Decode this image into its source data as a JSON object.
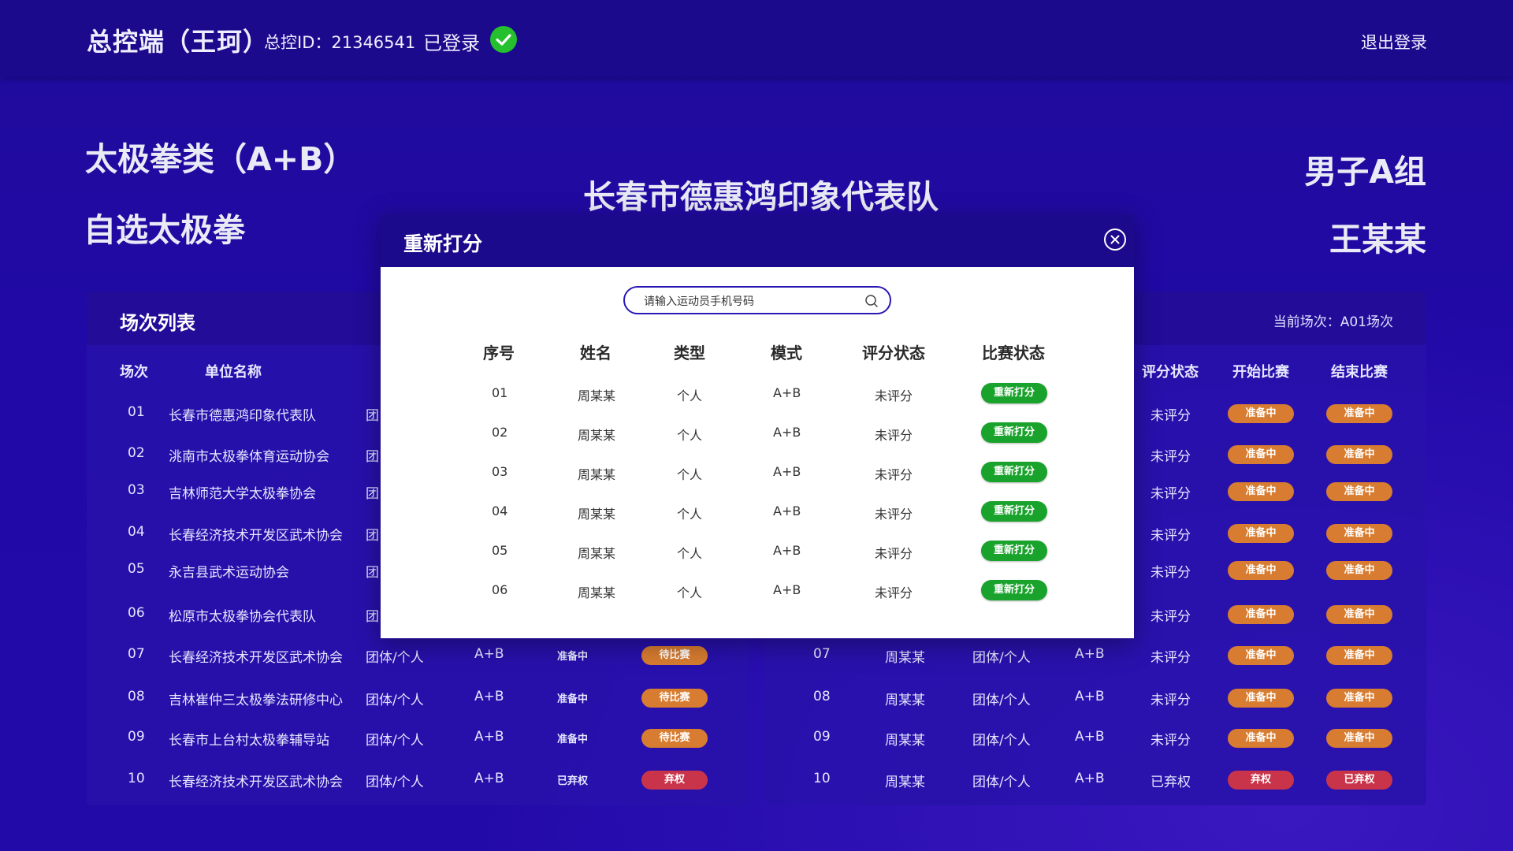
{
  "header": {
    "title": "总控端（王珂）",
    "id_text": "总控ID：21346541",
    "logged_in": "已登录",
    "logout": "退出登录"
  },
  "event": {
    "category": "太极拳类（A+B）",
    "name": "自选太极拳",
    "team": "长春市德惠鸿印象代表队",
    "group": "男子A组",
    "athlete": "王某某"
  },
  "left_panel": {
    "title": "场次列表",
    "columns": [
      "场次",
      "单位名称"
    ],
    "rows": [
      {
        "no": "01",
        "unit": "长春市德惠鸿印象代表队",
        "type": "团",
        "mode": "",
        "state": "",
        "status": "",
        "status_color": ""
      },
      {
        "no": "02",
        "unit": "洮南市太极拳体育运动协会",
        "type": "团",
        "mode": "",
        "state": "",
        "status": "",
        "status_color": ""
      },
      {
        "no": "03",
        "unit": "吉林师范大学太极拳协会",
        "type": "团",
        "mode": "",
        "state": "",
        "status": "",
        "status_color": ""
      },
      {
        "no": "04",
        "unit": "长春经济技术开发区武术协会",
        "type": "团",
        "mode": "",
        "state": "",
        "status": "",
        "status_color": ""
      },
      {
        "no": "05",
        "unit": "永吉县武术运动协会",
        "type": "团",
        "mode": "",
        "state": "",
        "status": "",
        "status_color": ""
      },
      {
        "no": "06",
        "unit": "松原市太极拳协会代表队",
        "type": "团",
        "mode": "",
        "state": "",
        "status": "",
        "status_color": ""
      },
      {
        "no": "07",
        "unit": "长春经济技术开发区武术协会",
        "type": "团体/个人",
        "mode": "A+B",
        "state": "准备中",
        "status": "待比赛",
        "status_color": "orange"
      },
      {
        "no": "08",
        "unit": "吉林崔仲三太极拳法研修中心",
        "type": "团体/个人",
        "mode": "A+B",
        "state": "准备中",
        "status": "待比赛",
        "status_color": "orange"
      },
      {
        "no": "09",
        "unit": "长春市上台村太极拳辅导站",
        "type": "团体/个人",
        "mode": "A+B",
        "state": "准备中",
        "status": "待比赛",
        "status_color": "orange"
      },
      {
        "no": "10",
        "unit": "长春经济技术开发区武术协会",
        "type": "团体/个人",
        "mode": "A+B",
        "state": "已弃权",
        "status": "弃权",
        "status_color": "red"
      }
    ]
  },
  "right_panel": {
    "current": "当前场次：A01场次",
    "columns": [
      "评分状态",
      "开始比赛",
      "结束比赛"
    ],
    "rows": [
      {
        "no": "",
        "name": "",
        "type": "",
        "mode": "",
        "score": "未评分",
        "start": "准备中",
        "end": "准备中",
        "start_color": "orange",
        "end_color": "orange"
      },
      {
        "no": "",
        "name": "",
        "type": "",
        "mode": "",
        "score": "未评分",
        "start": "准备中",
        "end": "准备中",
        "start_color": "orange",
        "end_color": "orange"
      },
      {
        "no": "",
        "name": "",
        "type": "",
        "mode": "",
        "score": "未评分",
        "start": "准备中",
        "end": "准备中",
        "start_color": "orange",
        "end_color": "orange"
      },
      {
        "no": "",
        "name": "",
        "type": "",
        "mode": "",
        "score": "未评分",
        "start": "准备中",
        "end": "准备中",
        "start_color": "orange",
        "end_color": "orange"
      },
      {
        "no": "",
        "name": "",
        "type": "",
        "mode": "",
        "score": "未评分",
        "start": "准备中",
        "end": "准备中",
        "start_color": "orange",
        "end_color": "orange"
      },
      {
        "no": "",
        "name": "",
        "type": "",
        "mode": "",
        "score": "未评分",
        "start": "准备中",
        "end": "准备中",
        "start_color": "orange",
        "end_color": "orange"
      },
      {
        "no": "07",
        "name": "周某某",
        "type": "团体/个人",
        "mode": "A+B",
        "score": "未评分",
        "start": "准备中",
        "end": "准备中",
        "start_color": "orange",
        "end_color": "orange"
      },
      {
        "no": "08",
        "name": "周某某",
        "type": "团体/个人",
        "mode": "A+B",
        "score": "未评分",
        "start": "准备中",
        "end": "准备中",
        "start_color": "orange",
        "end_color": "orange"
      },
      {
        "no": "09",
        "name": "周某某",
        "type": "团体/个人",
        "mode": "A+B",
        "score": "未评分",
        "start": "准备中",
        "end": "准备中",
        "start_color": "orange",
        "end_color": "orange"
      },
      {
        "no": "10",
        "name": "周某某",
        "type": "团体/个人",
        "mode": "A+B",
        "score": "已弃权",
        "start": "弃权",
        "end": "已弃权",
        "start_color": "red",
        "end_color": "red"
      }
    ]
  },
  "modal": {
    "title": "重新打分",
    "search_placeholder": "请输入运动员手机号码",
    "columns": [
      "序号",
      "姓名",
      "类型",
      "模式",
      "评分状态",
      "比赛状态"
    ],
    "rows": [
      {
        "no": "01",
        "name": "周某某",
        "type": "个人",
        "mode": "A+B",
        "score": "未评分",
        "action": "重新打分"
      },
      {
        "no": "02",
        "name": "周某某",
        "type": "个人",
        "mode": "A+B",
        "score": "未评分",
        "action": "重新打分"
      },
      {
        "no": "03",
        "name": "周某某",
        "type": "个人",
        "mode": "A+B",
        "score": "未评分",
        "action": "重新打分"
      },
      {
        "no": "04",
        "name": "周某某",
        "type": "个人",
        "mode": "A+B",
        "score": "未评分",
        "action": "重新打分"
      },
      {
        "no": "05",
        "name": "周某某",
        "type": "个人",
        "mode": "A+B",
        "score": "未评分",
        "action": "重新打分"
      },
      {
        "no": "06",
        "name": "周某某",
        "type": "个人",
        "mode": "A+B",
        "score": "未评分",
        "action": "重新打分"
      }
    ]
  },
  "colors": {
    "bg": "#2009a6",
    "topbar": "#1c0a8c",
    "orange": "#d77c30",
    "red": "#c9344a",
    "green": "#1aa32c"
  },
  "icons": [
    "check-circle-icon",
    "close-circle-icon",
    "search-icon"
  ]
}
